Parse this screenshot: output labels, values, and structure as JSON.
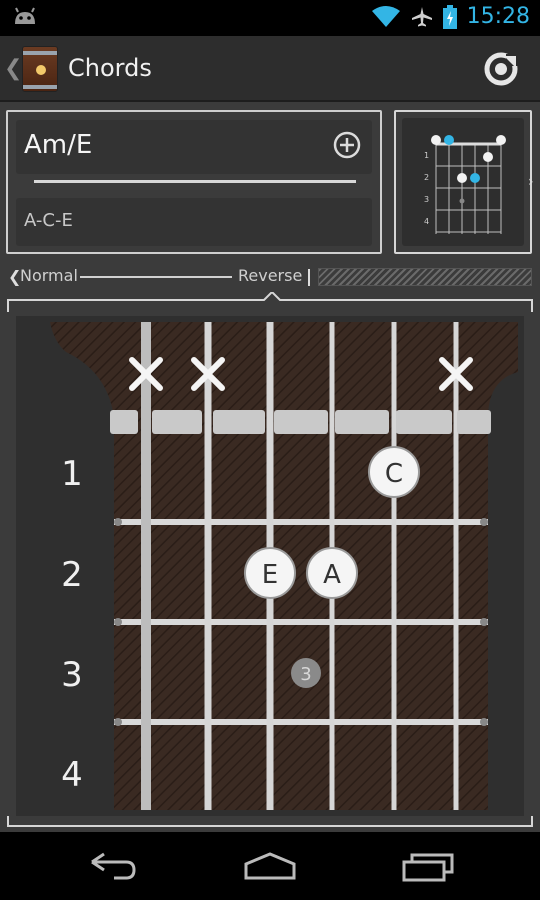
{
  "status_bar": {
    "time": "15:28"
  },
  "action_bar": {
    "title": "Chords"
  },
  "chord": {
    "name": "Am/E",
    "notes": "A-C-E"
  },
  "mode": {
    "normal_label": "Normal",
    "reverse_label": "Reverse"
  },
  "fretboard": {
    "fret_numbers": [
      "1",
      "2",
      "3",
      "4"
    ],
    "muted_strings": [
      1,
      2,
      6
    ],
    "note_markers": [
      {
        "label": "C",
        "string": 5,
        "fret": 1
      },
      {
        "label": "E",
        "string": 3,
        "fret": 2
      },
      {
        "label": "A",
        "string": 4,
        "fret": 2
      }
    ],
    "hint_markers": [
      {
        "label": "3",
        "string": 3,
        "fret": 3
      }
    ]
  },
  "mini_diagram": {
    "fret_numbers": [
      "1",
      "2",
      "3",
      "4"
    ]
  },
  "colors": {
    "accent": "#33b5e5",
    "wood": "#3a2a22"
  }
}
